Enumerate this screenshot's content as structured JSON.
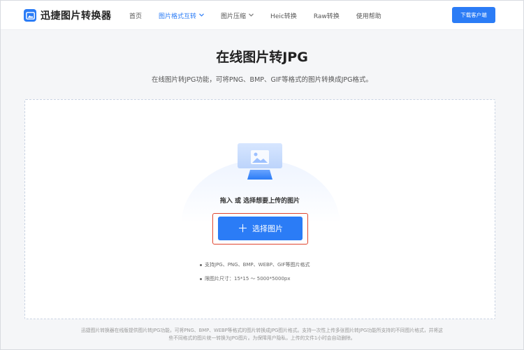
{
  "header": {
    "brand": "迅捷图片转换器",
    "nav": [
      {
        "label": "首页",
        "active": false,
        "dropdown": false
      },
      {
        "label": "图片格式互转",
        "active": true,
        "dropdown": true
      },
      {
        "label": "图片压缩",
        "active": false,
        "dropdown": true
      },
      {
        "label": "Heic转换",
        "active": false,
        "dropdown": false
      },
      {
        "label": "Raw转换",
        "active": false,
        "dropdown": false
      },
      {
        "label": "使用帮助",
        "active": false,
        "dropdown": false
      }
    ],
    "download_label": "下载客户端"
  },
  "main": {
    "title": "在线图片转JPG",
    "subtitle": "在线图片转JPG功能，可将PNG、BMP、GIF等格式的图片转换成JPG格式。"
  },
  "upload": {
    "drop_text": "拖入 或 选择想要上传的图片",
    "select_label": "选择图片",
    "notes": [
      "支持JPG、PNG、BMP、WEBP、GIF等图片格式",
      "限图片尺寸：15*15 ～ 5000*5000px"
    ]
  },
  "footer": {
    "line1": "迅捷图片转换器在线版提供图片转JPG功能，可将PNG、BMP、WEBP等格式的图片转换成JPG图片格式。支持一次性上传多张图片转JPG功能所支持的不同图片格式，并将这",
    "line2": "些不同格式的图片统一转换为JPG图片。为保障用户隐私，上传的文件1小时会自动删除。"
  },
  "colors": {
    "accent": "#2b7cf6",
    "highlight_border": "#e0452e"
  },
  "icons": {
    "logo": "image-icon",
    "dropdown": "chevron-down-icon",
    "upload_illustration": "monitor-image-icon",
    "select": "plus-icon"
  }
}
